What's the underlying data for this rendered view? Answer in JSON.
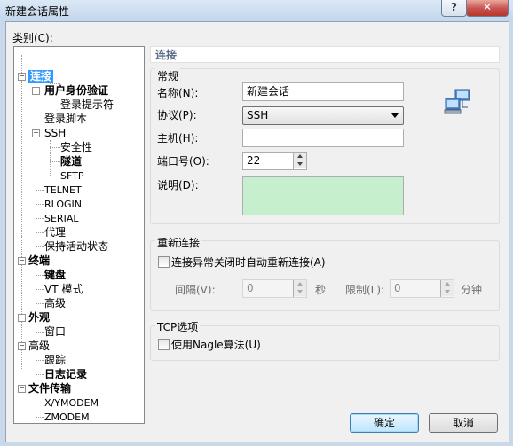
{
  "window": {
    "title": "新建会话属性",
    "help_label": "?",
    "close_label": "✕"
  },
  "category_label": "类别(C):",
  "tree": {
    "connection": "连接",
    "user_auth": "用户身份验证",
    "login_prompt": "登录提示符",
    "login_script": "登录脚本",
    "ssh": "SSH",
    "security": "安全性",
    "tunnel": "隧道",
    "sftp": "SFTP",
    "telnet": "TELNET",
    "rlogin": "RLOGIN",
    "serial": "SERIAL",
    "proxy": "代理",
    "keepalive": "保持活动状态",
    "terminal": "终端",
    "keyboard": "键盘",
    "vt_mode": "VT 模式",
    "terminal_advanced": "高级",
    "appearance": "外观",
    "window": "窗口",
    "advanced": "高级",
    "trace": "跟踪",
    "logging": "日志记录",
    "file_transfer": "文件传输",
    "xymodem": "X/YMODEM",
    "zmodem": "ZMODEM"
  },
  "panel": {
    "header": "连接",
    "general": {
      "title": "常规",
      "name_label": "名称(N):",
      "name_value": "新建会话",
      "protocol_label": "协议(P):",
      "protocol_value": "SSH",
      "host_label": "主机(H):",
      "host_value": "",
      "port_label": "端口号(O):",
      "port_value": "22",
      "desc_label": "说明(D):",
      "desc_value": ""
    },
    "reconnect": {
      "title": "重新连接",
      "auto_label": "连接异常关闭时自动重新连接(A)",
      "interval_label": "间隔(V):",
      "interval_value": "0",
      "interval_unit": "秒",
      "limit_label": "限制(L):",
      "limit_value": "0",
      "limit_unit": "分钟"
    },
    "tcp": {
      "title": "TCP选项",
      "nagle_label": "使用Nagle算法(U)"
    }
  },
  "buttons": {
    "ok": "确定",
    "cancel": "取消"
  },
  "colors": {
    "selection": "#3399ff",
    "desc_bg": "#c6efce"
  }
}
